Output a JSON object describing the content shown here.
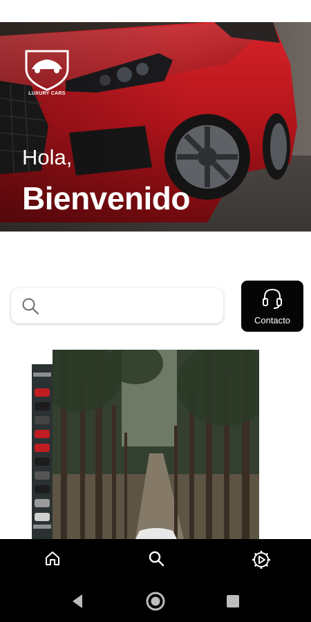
{
  "hero": {
    "logo_text": "LUXURY CARS",
    "greeting": "Hola,",
    "welcome": "Bienvenido"
  },
  "search": {
    "placeholder": "",
    "value": "",
    "icon": "search-icon"
  },
  "contact": {
    "label": "Contacto",
    "icon": "headset-icon"
  },
  "carousel": {
    "images": [
      "parking-garage-image",
      "forest-road-car-image"
    ]
  },
  "bottom_nav": {
    "items": [
      {
        "icon": "home-icon"
      },
      {
        "icon": "search-icon"
      },
      {
        "icon": "settings-play-icon"
      }
    ]
  },
  "system_nav": {
    "items": [
      {
        "icon": "back-icon"
      },
      {
        "icon": "home-circle-icon"
      },
      {
        "icon": "recents-icon"
      }
    ]
  },
  "colors": {
    "primary": "#000000",
    "car_red": "#c4161c",
    "background": "#ffffff"
  }
}
